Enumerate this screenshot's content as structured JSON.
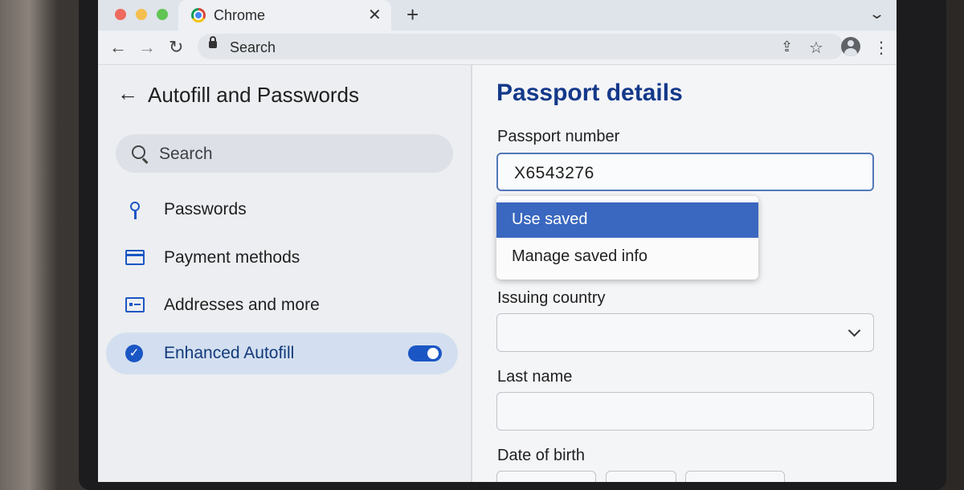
{
  "browser": {
    "tab_title": "Chrome",
    "tab_close_glyph": "✕",
    "new_tab_glyph": "+",
    "tab_menu_glyph": "⌄",
    "address_text": "Search",
    "nav": {
      "back_glyph": "←",
      "forward_glyph": "→",
      "reload_glyph": "↻"
    },
    "actions": {
      "share_glyph": "⇪",
      "bookmark_glyph": "☆",
      "menu_glyph": "⋮"
    }
  },
  "settings": {
    "back_glyph": "←",
    "title": "Autofill and Passwords",
    "search_placeholder": "Search",
    "items": [
      {
        "label": "Passwords",
        "icon": "key-icon"
      },
      {
        "label": "Payment methods",
        "icon": "credit-card-icon"
      },
      {
        "label": "Addresses and more",
        "icon": "id-card-icon"
      },
      {
        "label": "Enhanced Autofill",
        "icon": "checkmark-shield-icon",
        "active": true,
        "toggle_on": true
      }
    ],
    "check_glyph": "✓"
  },
  "form": {
    "title": "Passport details",
    "fields": {
      "passport_number": {
        "label": "Passport number",
        "value": "X6543276"
      },
      "issuing_country": {
        "label": "Issuing country",
        "value": ""
      },
      "last_name": {
        "label": "Last name",
        "value": ""
      },
      "date_of_birth": {
        "label": "Date of birth"
      }
    },
    "autofill_menu": {
      "options": [
        "Use saved",
        "Manage saved info"
      ],
      "selected": "Use saved"
    }
  },
  "colors": {
    "accent": "#1a56c4",
    "title_blue": "#14398a",
    "selected_option": "#3a67bf",
    "active_nav_bg": "#d3dff0"
  }
}
